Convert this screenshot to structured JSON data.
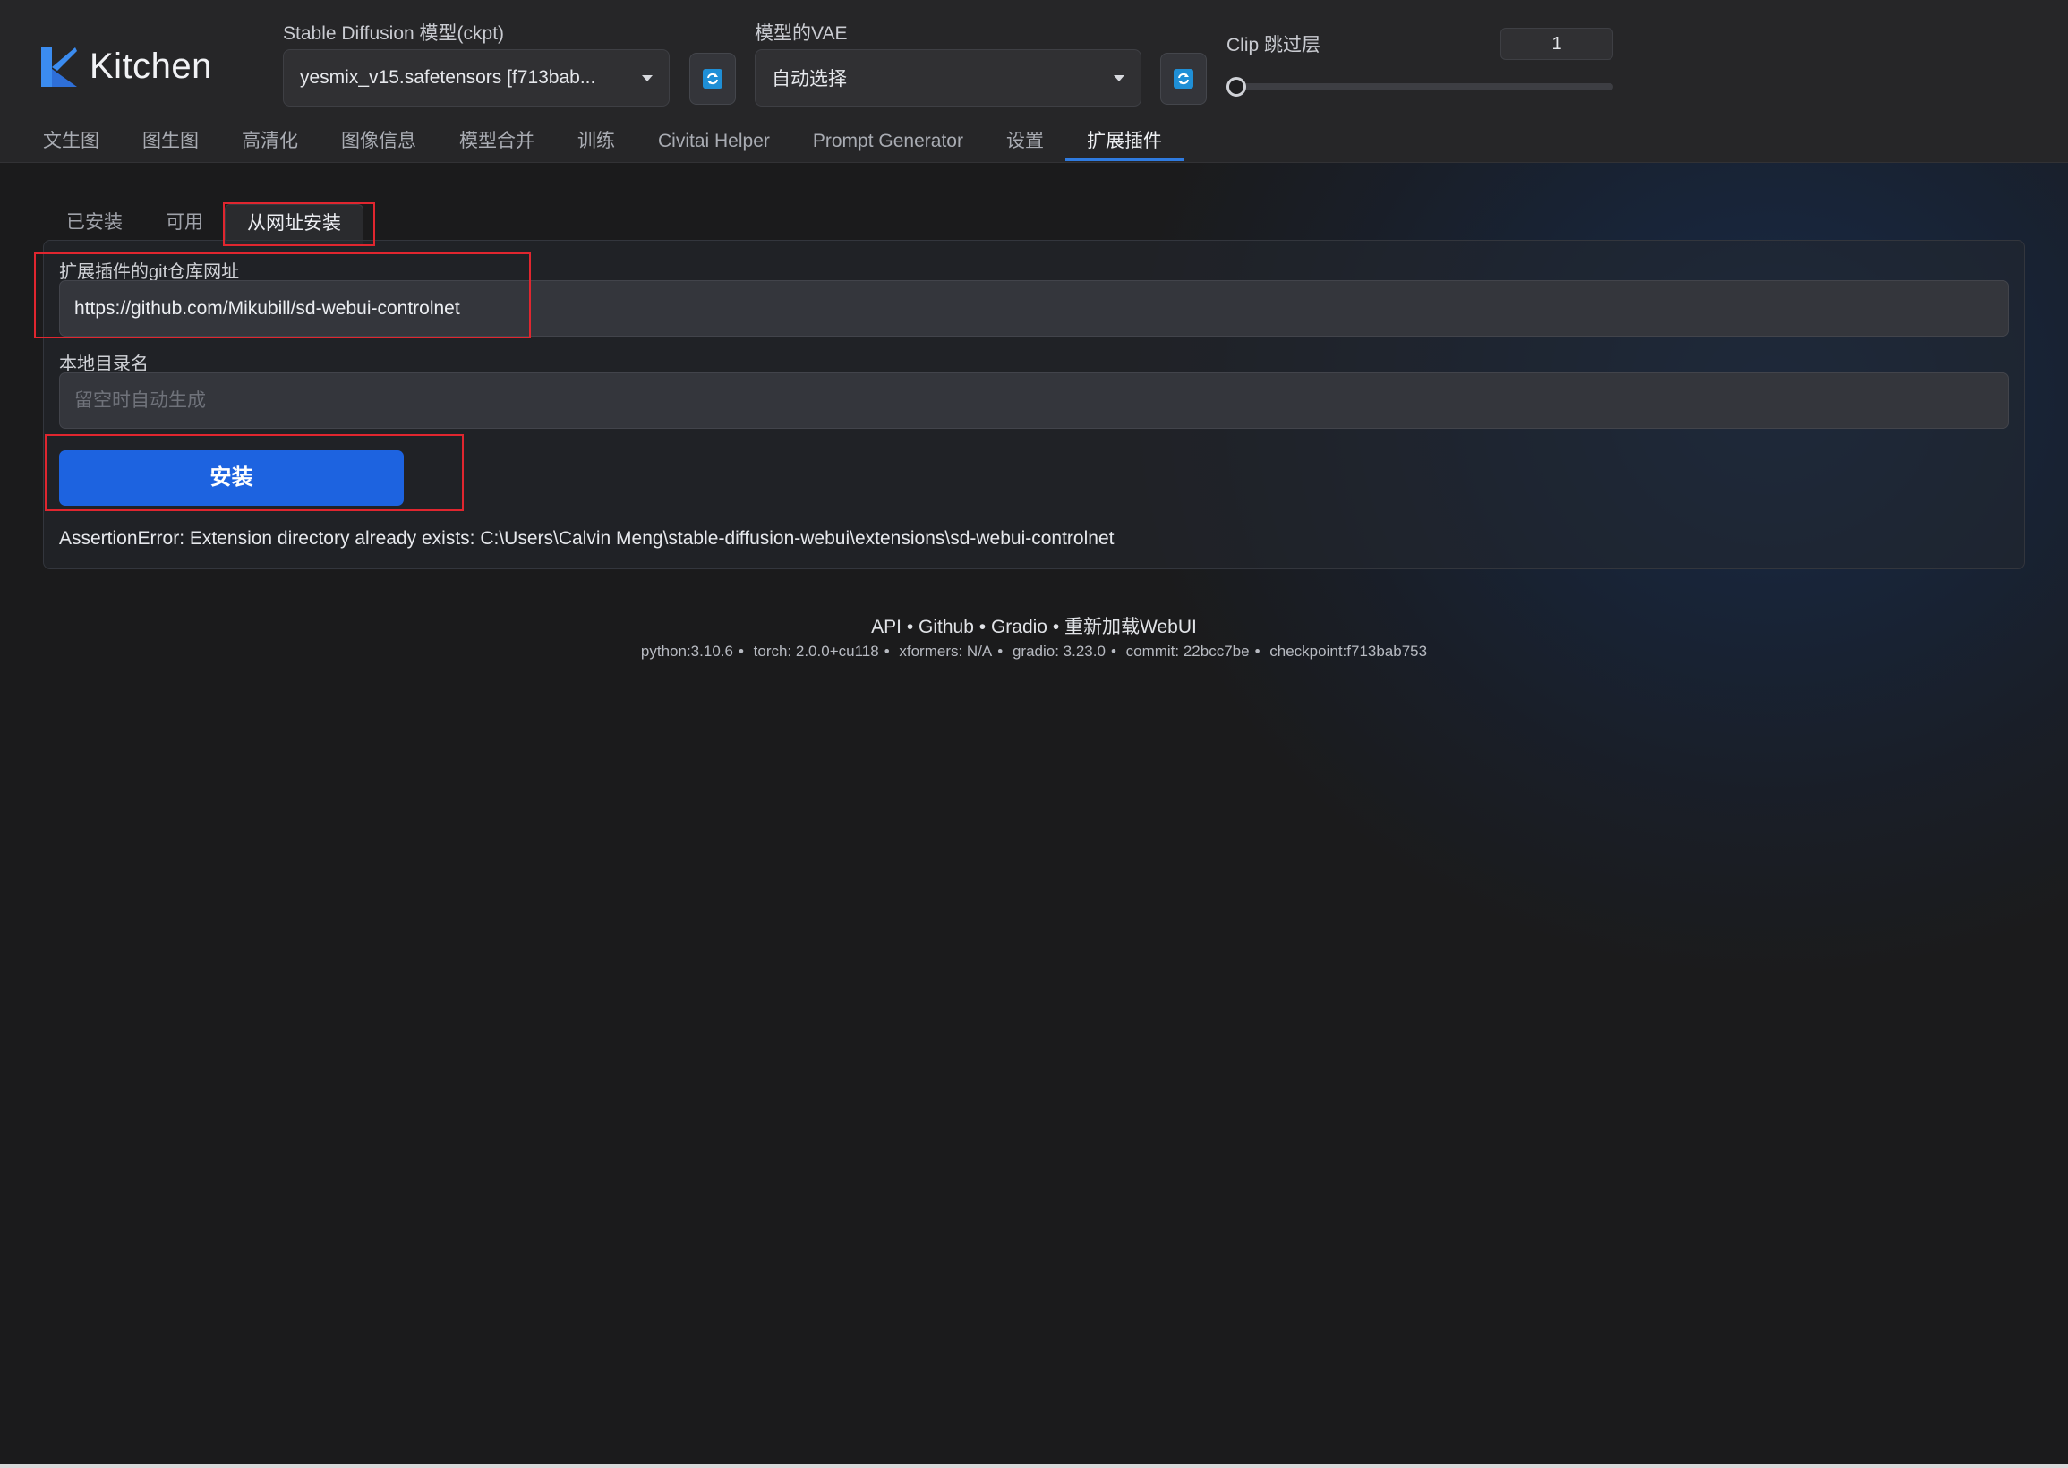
{
  "app": {
    "title": "Kitchen",
    "accent": "#1d63e0"
  },
  "header": {
    "ckpt_label": "Stable Diffusion 模型(ckpt)",
    "ckpt_value": "yesmix_v15.safetensors [f713bab...",
    "vae_label": "模型的VAE",
    "vae_value": "自动选择",
    "clip_label": "Clip 跳过层",
    "clip_value": "1",
    "clip_slider_fraction": 0
  },
  "main_tabs": [
    {
      "label": "文生图"
    },
    {
      "label": "图生图"
    },
    {
      "label": "高清化"
    },
    {
      "label": "图像信息"
    },
    {
      "label": "模型合并"
    },
    {
      "label": "训练"
    },
    {
      "label": "Civitai Helper"
    },
    {
      "label": "Prompt Generator"
    },
    {
      "label": "设置"
    },
    {
      "label": "扩展插件"
    }
  ],
  "active_main_tab": "扩展插件",
  "sub_tabs": [
    {
      "label": "已安装"
    },
    {
      "label": "可用"
    },
    {
      "label": "从网址安装"
    }
  ],
  "active_sub_tab": "从网址安装",
  "form": {
    "git_label": "扩展插件的git仓库网址",
    "git_value": "https://github.com/Mikubill/sd-webui-controlnet",
    "dir_label": "本地目录名",
    "dir_placeholder": "留空时自动生成",
    "install_label": "安装",
    "error": "AssertionError: Extension directory already exists: C:\\Users\\Calvin Meng\\stable-diffusion-webui\\extensions\\sd-webui-controlnet"
  },
  "footer": {
    "links": [
      "API",
      "Github",
      "Gradio",
      "重新加载WebUI"
    ],
    "separator": " • ",
    "python": "python:3.10.6",
    "torch": "torch: 2.0.0+cu118",
    "xformers": "xformers: N/A",
    "gradio": "gradio: 3.23.0",
    "commit": "commit: 22bcc7be",
    "checkpoint": "checkpoint:f713bab753"
  },
  "icons": [
    "kitchen-logo-icon",
    "chevron-down-icon",
    "refresh-icon"
  ]
}
